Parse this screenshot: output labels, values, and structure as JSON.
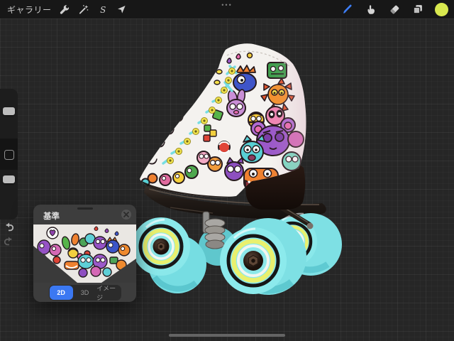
{
  "toolbar": {
    "gallery_label": "ギャラリー",
    "menu_dots_label": "•••",
    "selection_glyph": "S",
    "left_tool_icons": [
      "actions-wrench-icon",
      "adjustments-wand-icon",
      "selection-s-icon",
      "transform-arrow-icon"
    ],
    "right_tool_icons": [
      "brush-icon",
      "smudge-finger-icon",
      "eraser-icon",
      "layers-icon",
      "color-swatch"
    ],
    "active_tool": "brush",
    "accent_color": "#3d7ef6",
    "color_swatch_color": "#d9e94f"
  },
  "sidebar": {
    "icons": [
      "brush-size-slider",
      "modify-button",
      "opacity-slider",
      "undo-icon",
      "redo-icon"
    ]
  },
  "reference_panel": {
    "title": "基準",
    "tabs": [
      {
        "label": "2D",
        "selected": true
      },
      {
        "label": "3D",
        "selected": false
      },
      {
        "label": "イメージ",
        "selected": false
      }
    ],
    "selected_tab_color": "#3b78f2",
    "thumbnail": "2d-doodle-artwork-preview"
  },
  "canvas": {
    "content": "3d-roller-skate-model-with-doodle-art",
    "background_color": "#262626",
    "boot_color": "#f4f2ef",
    "lace_color": "#76dde2",
    "eyelet_color": "#f1e34d",
    "wheel_color": "#7fe2e5",
    "wheel_ring_yellow": "#e9f06e",
    "sole_color": "#1b110d"
  }
}
